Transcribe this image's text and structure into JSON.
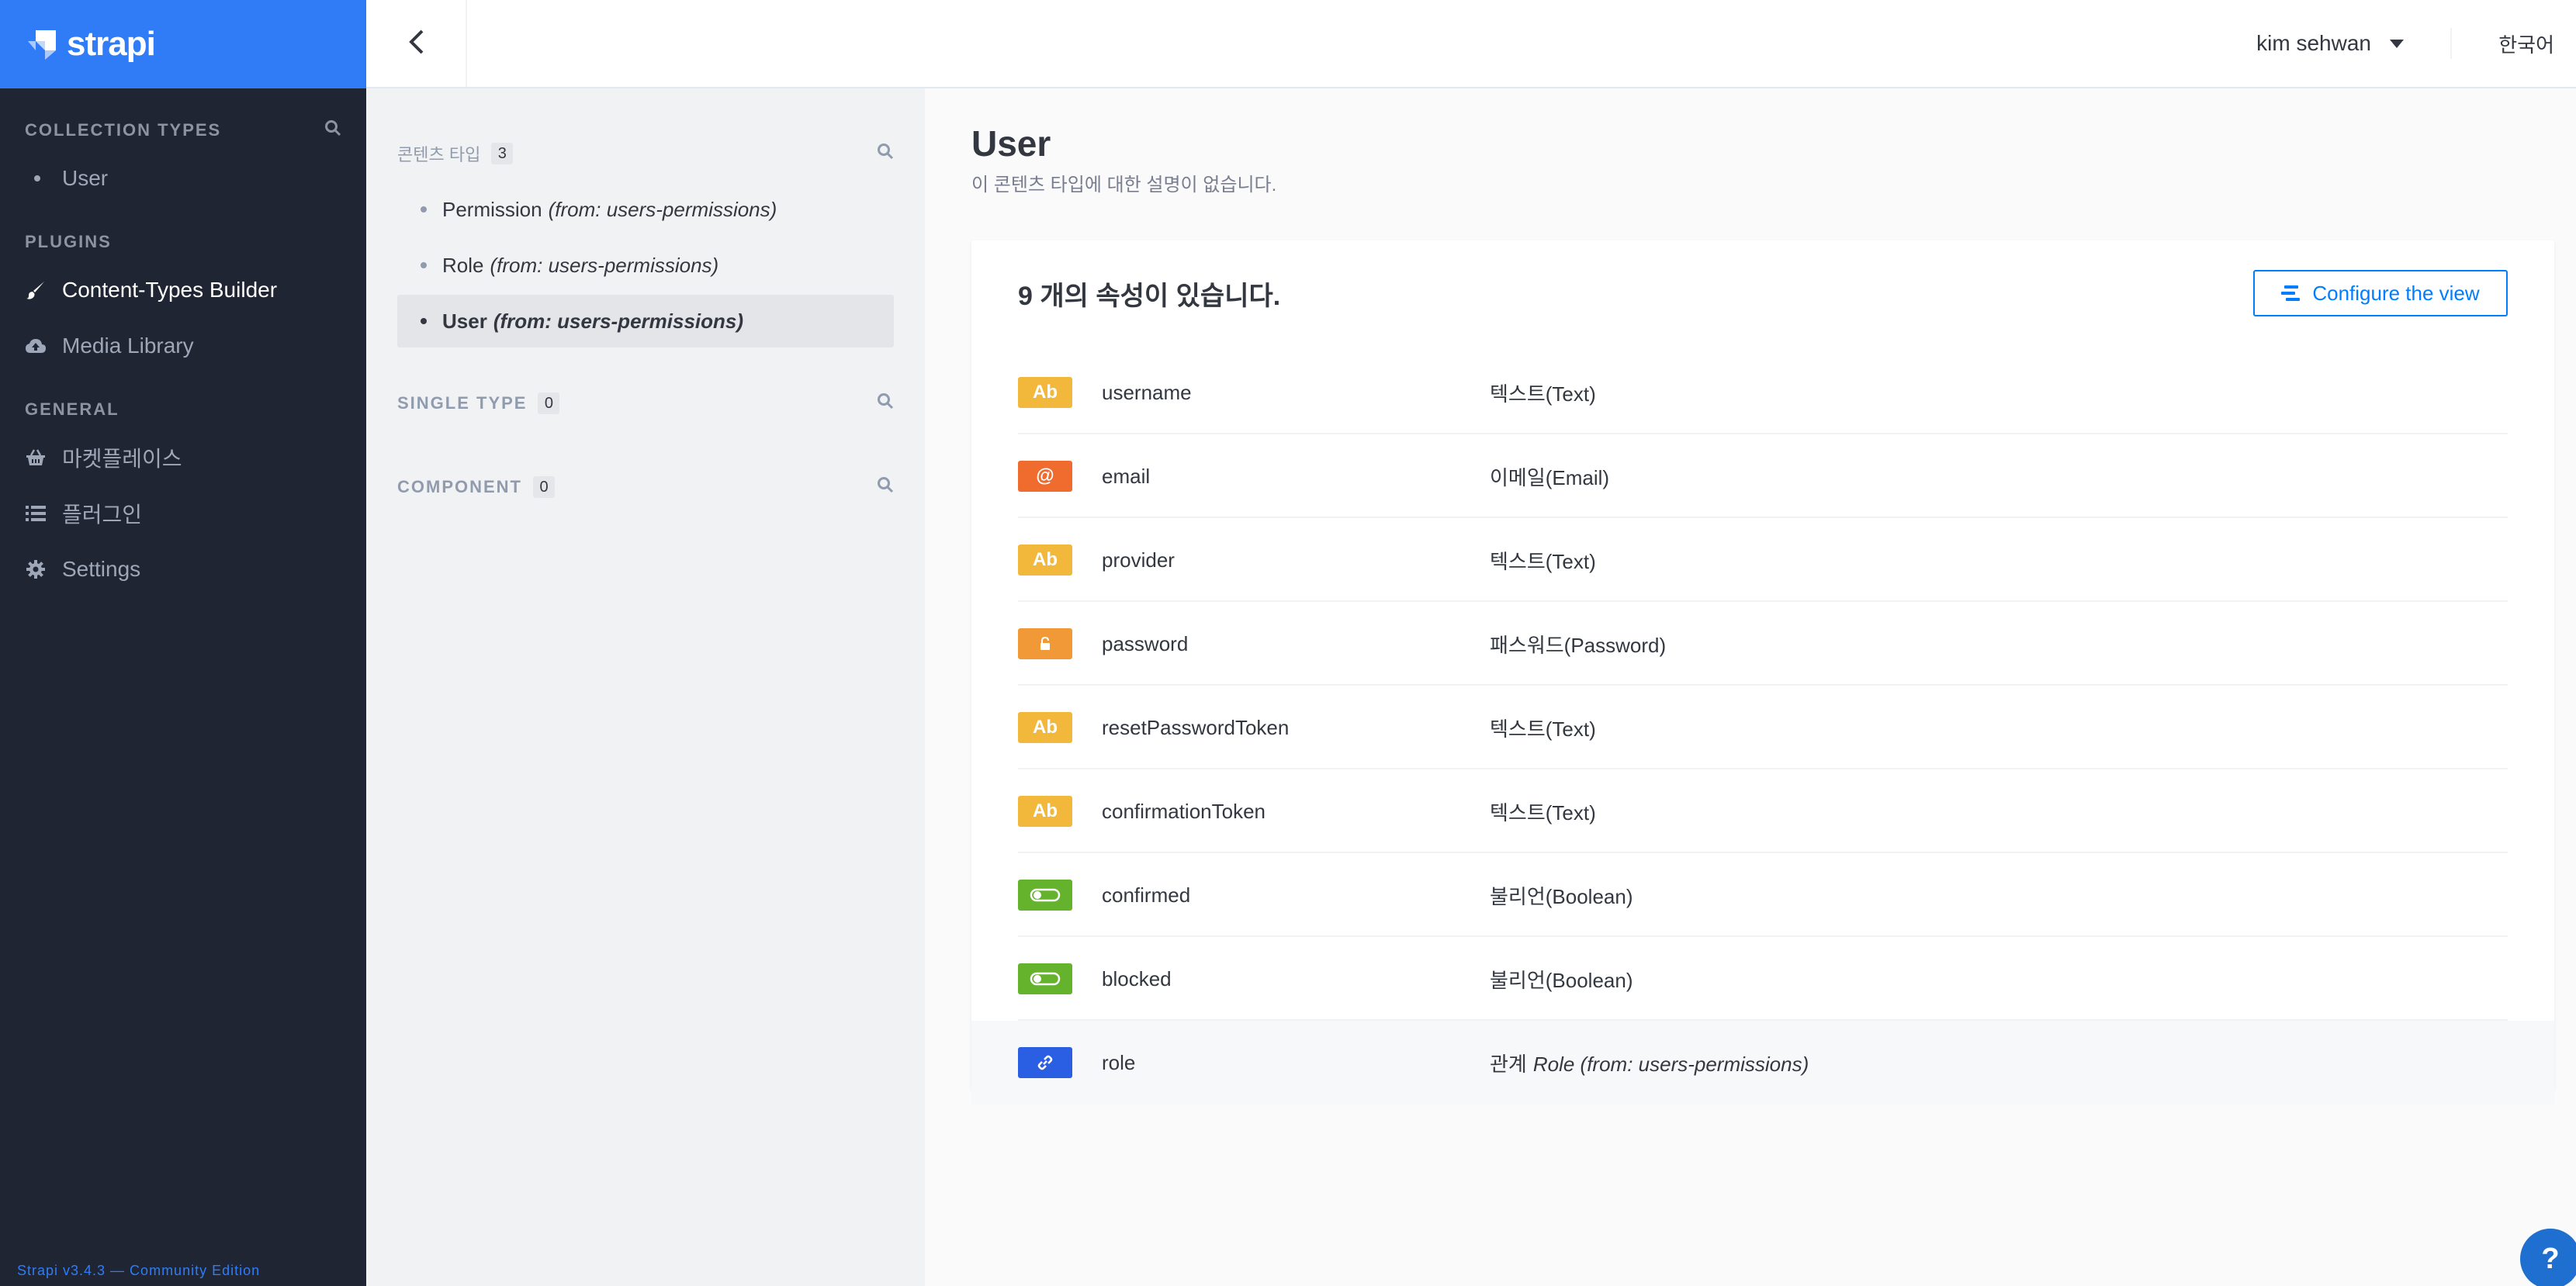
{
  "app": {
    "brand": "strapi",
    "version_footer": "Strapi v3.4.3 — Community Edition"
  },
  "leftnav": {
    "collection_types": {
      "title": "COLLECTION TYPES",
      "items": [
        {
          "label": "User"
        }
      ]
    },
    "plugins": {
      "title": "PLUGINS",
      "items": [
        {
          "label": "Content-Types Builder",
          "icon": "brush-icon",
          "active": true
        },
        {
          "label": "Media Library",
          "icon": "cloud-upload-icon"
        }
      ]
    },
    "general": {
      "title": "GENERAL",
      "items": [
        {
          "label": "마켓플레이스",
          "icon": "basket-icon"
        },
        {
          "label": "플러그인",
          "icon": "list-icon"
        },
        {
          "label": "Settings",
          "icon": "gear-icon"
        }
      ]
    }
  },
  "header": {
    "user_name": "kim sehwan",
    "language": "한국어"
  },
  "ctb": {
    "content_types": {
      "title": "콘텐츠 타입",
      "count": "3",
      "items": [
        {
          "name": "Permission",
          "from": "(from: users-permissions)"
        },
        {
          "name": "Role",
          "from": "(from: users-permissions)"
        },
        {
          "name": "User",
          "from": "(from: users-permissions)",
          "active": true
        }
      ]
    },
    "single_types": {
      "title": "SINGLE TYPE",
      "count": "0"
    },
    "components": {
      "title": "COMPONENT",
      "count": "0"
    }
  },
  "main": {
    "title": "User",
    "description": "이 콘텐츠 타입에 대한 설명이 없습니다.",
    "attribute_count": "9 개의 속성이 있습니다.",
    "configure_label": "Configure the view",
    "attributes": [
      {
        "name": "username",
        "type": "텍스트(Text)",
        "badge": "Ab",
        "badge_color": "#f2b83c"
      },
      {
        "name": "email",
        "type": "이메일(Email)",
        "badge": "@",
        "badge_color": "#f06b2e"
      },
      {
        "name": "provider",
        "type": "텍스트(Text)",
        "badge": "Ab",
        "badge_color": "#f2b83c"
      },
      {
        "name": "password",
        "type": "패스워드(Password)",
        "badge": "lock",
        "badge_color": "#f19936"
      },
      {
        "name": "resetPasswordToken",
        "type": "텍스트(Text)",
        "badge": "Ab",
        "badge_color": "#f2b83c"
      },
      {
        "name": "confirmationToken",
        "type": "텍스트(Text)",
        "badge": "Ab",
        "badge_color": "#f2b83c"
      },
      {
        "name": "confirmed",
        "type": "불리언(Boolean)",
        "badge": "toggle",
        "badge_color": "#65b22d"
      },
      {
        "name": "blocked",
        "type": "불리언(Boolean)",
        "badge": "toggle",
        "badge_color": "#65b22d"
      },
      {
        "name": "role",
        "type": "관계",
        "relation": "Role (from: users-permissions)",
        "badge": "link",
        "badge_color": "#2a5ee3"
      }
    ]
  },
  "help": {
    "label": "?"
  }
}
